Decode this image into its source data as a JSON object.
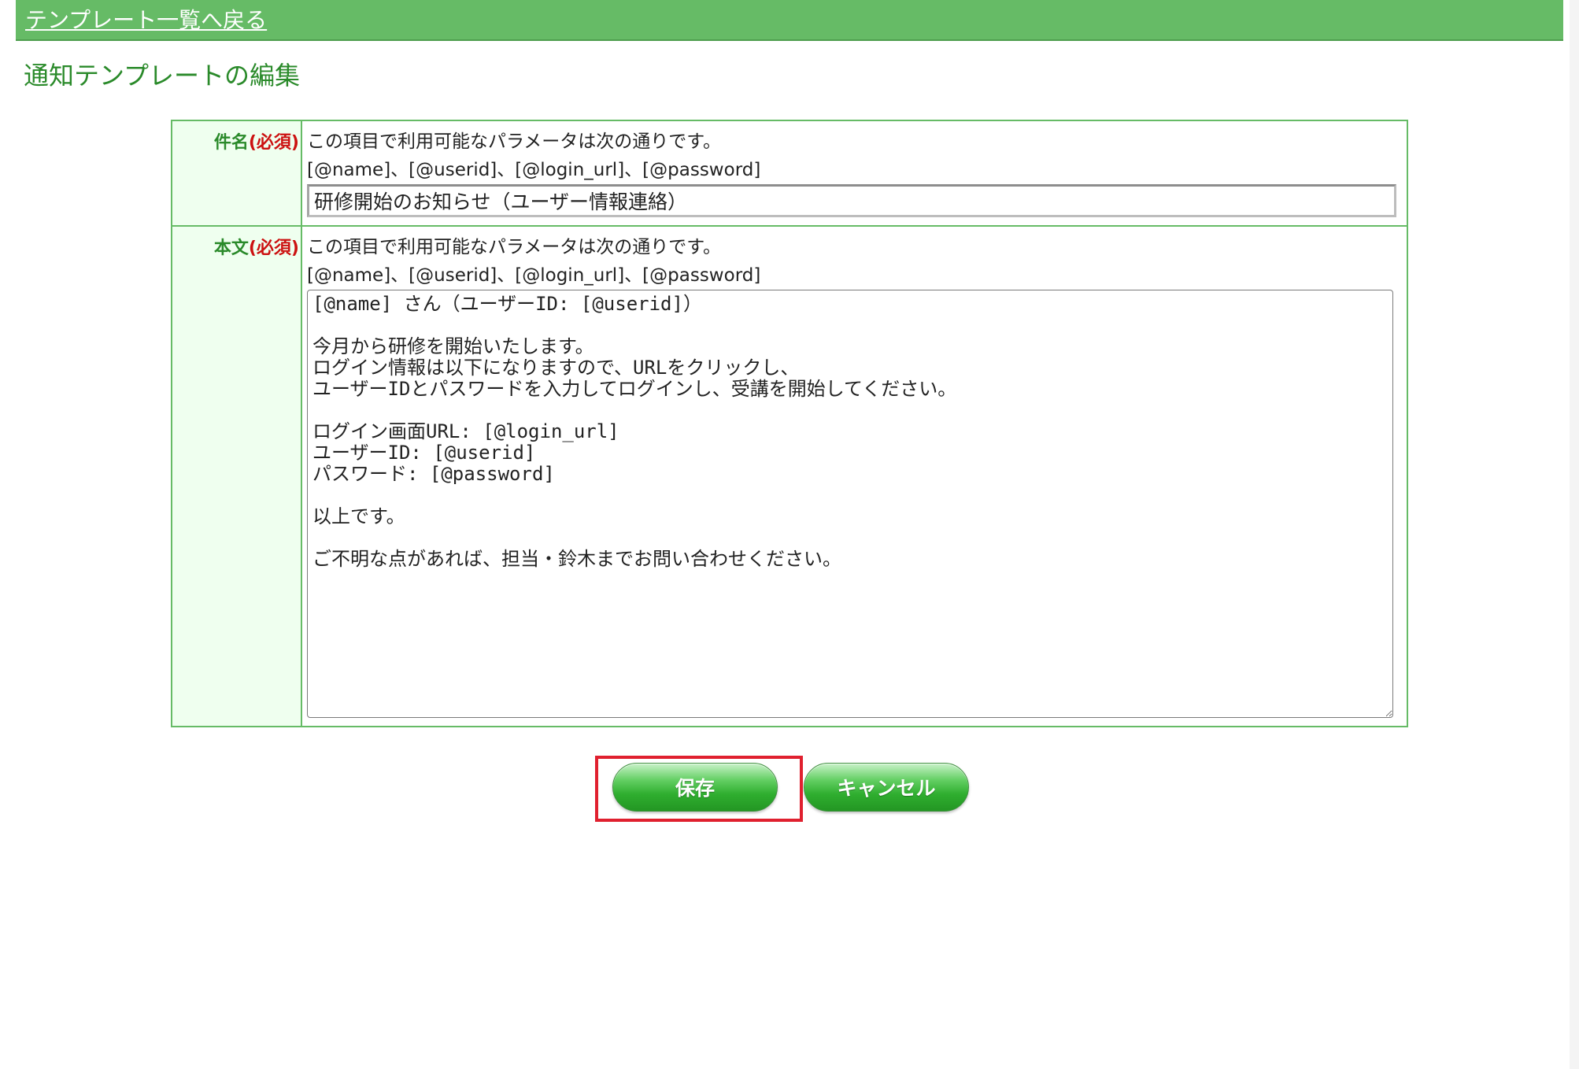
{
  "header": {
    "back_link": "テンプレート一覧へ戻る"
  },
  "page_title": "通知テンプレートの編集",
  "form": {
    "subject": {
      "label": "件名",
      "required": "(必須)",
      "hint_line1": "この項目で利用可能なパラメータは次の通りです。",
      "hint_line2": "[@name]、[@userid]、[@login_url]、[@password]",
      "value": "研修開始のお知らせ（ユーザー情報連絡）"
    },
    "body": {
      "label": "本文",
      "required": "(必須)",
      "hint_line1": "この項目で利用可能なパラメータは次の通りです。",
      "hint_line2": "[@name]、[@userid]、[@login_url]、[@password]",
      "value": "[@name] さん（ユーザーID: [@userid]）\n\n今月から研修を開始いたします。\nログイン情報は以下になりますので、URLをクリックし、\nユーザーIDとパスワードを入力してログインし、受講を開始してください。\n\nログイン画面URL: [@login_url]\nユーザーID: [@userid]\nパスワード: [@password]\n\n以上です。\n\nご不明な点があれば、担当・鈴木までお問い合わせください。"
    }
  },
  "buttons": {
    "save": "保存",
    "cancel": "キャンセル"
  },
  "colors": {
    "header_bg": "#66bb66",
    "title_green": "#2a8a2a",
    "required_red": "#cc1111",
    "highlight_red": "#e0202f",
    "label_bg": "#efffef"
  }
}
